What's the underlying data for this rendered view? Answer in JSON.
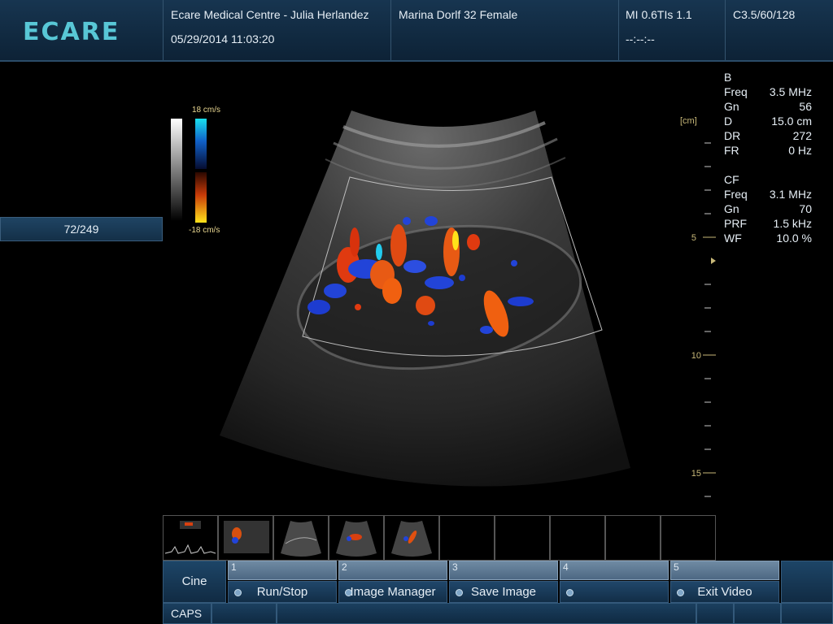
{
  "header": {
    "logo_text": "ECARE",
    "clinic": "Ecare Medical Centre - Julia Herlandez",
    "datetime": "05/29/2014 11:03:20",
    "patient": "Marina Dorlf 32 Female",
    "mi_tis": "MI 0.6TIs 1.1",
    "timer": "--:--:--",
    "probe": "C3.5/60/128"
  },
  "frame_counter": "72/249",
  "color_scale": {
    "top_label": "18 cm/s",
    "bottom_label": "-18 cm/s"
  },
  "params": {
    "b_title": "B",
    "b": [
      {
        "name": "Freq",
        "value": "3.5 MHz"
      },
      {
        "name": "Gn",
        "value": "56"
      },
      {
        "name": "D",
        "value": "15.0 cm"
      },
      {
        "name": "DR",
        "value": "272"
      },
      {
        "name": "FR",
        "value": "0 Hz"
      }
    ],
    "cf_title": "CF",
    "cf": [
      {
        "name": "Freq",
        "value": "3.1 MHz"
      },
      {
        "name": "Gn",
        "value": "70"
      },
      {
        "name": "PRF",
        "value": "1.5 kHz"
      },
      {
        "name": "WF",
        "value": "10.0 %"
      }
    ]
  },
  "depth_scale": {
    "unit": "[cm]",
    "labels": [
      "5",
      "10",
      "15"
    ]
  },
  "toolbar": {
    "cine_label": "Cine",
    "keys": [
      {
        "num": "1",
        "label": "Run/Stop"
      },
      {
        "num": "2",
        "label": "Image Manager"
      },
      {
        "num": "3",
        "label": "Save Image"
      },
      {
        "num": "4",
        "label": ""
      },
      {
        "num": "5",
        "label": "Exit Video"
      }
    ]
  },
  "status": {
    "caps": "CAPS"
  },
  "colors": {
    "accent_logo": "#58c7d6",
    "header_bg": "#173550",
    "depth_tick": "#c8b878"
  },
  "icons": [
    "velocity-color-bar-icon",
    "grayscale-bar-icon",
    "focus-marker-icon",
    "key-indicator-dot-icon"
  ]
}
